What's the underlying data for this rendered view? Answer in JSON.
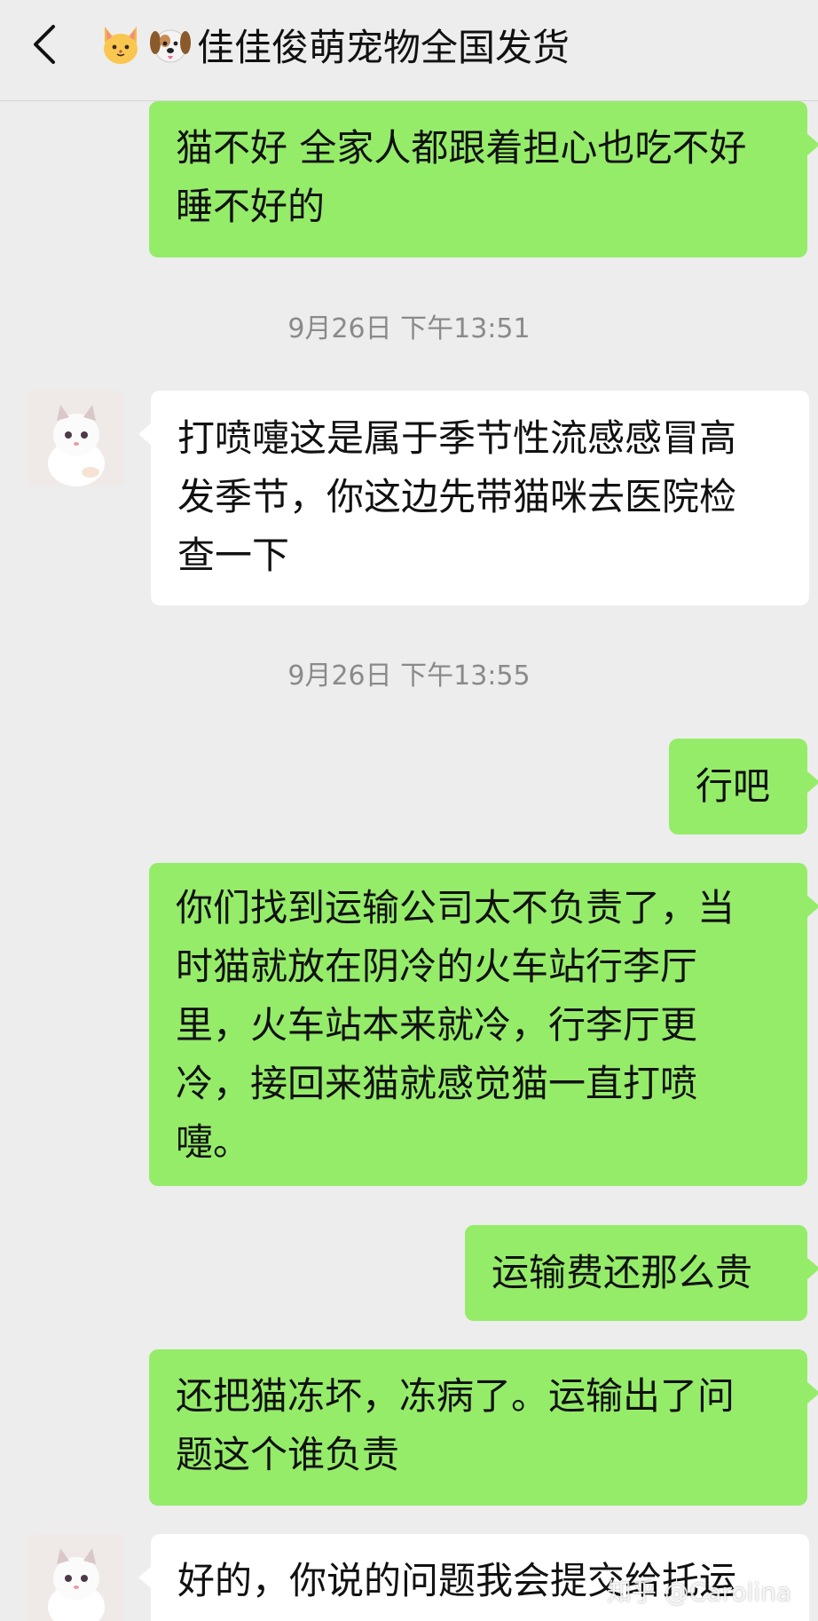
{
  "header": {
    "title": "佳佳俊萌宠物全国发货",
    "icons": [
      "chevron-left-icon",
      "cat-face-icon",
      "dog-face-icon"
    ]
  },
  "messages": [
    {
      "side": "sent",
      "lines": [
        "猫不好 全家人都跟着担心也吃不好",
        "睡不好的"
      ]
    },
    {
      "timestamp": "9月26日 下午13:51"
    },
    {
      "side": "recv",
      "lines": [
        "打喷嚏这是属于季节性流感感冒高",
        "发季节，你这边先带猫咪去医院检",
        "查一下"
      ]
    },
    {
      "timestamp": "9月26日 下午13:55"
    },
    {
      "side": "sent",
      "lines": [
        "行吧"
      ]
    },
    {
      "side": "sent",
      "lines": [
        "你们找到运输公司太不负责了，当",
        "时猫就放在阴冷的火车站行李厅",
        "里，火车站本来就冷，行李厅更",
        "冷，接回来猫就感觉猫一直打喷",
        "嚏。"
      ]
    },
    {
      "side": "sent",
      "lines": [
        "运输费还那么贵"
      ]
    },
    {
      "side": "sent",
      "lines": [
        "还把猫冻坏，冻病了。运输出了问",
        "题这个谁负责"
      ]
    },
    {
      "side": "recv",
      "lines": [
        "好的，你说的问题我会提交给托运"
      ]
    }
  ],
  "watermark": "知乎 @Carolina",
  "colors": {
    "background": "#ededed",
    "sent_bubble": "#95ec69",
    "recv_bubble": "#ffffff",
    "timestamp": "#8a8a8a"
  }
}
